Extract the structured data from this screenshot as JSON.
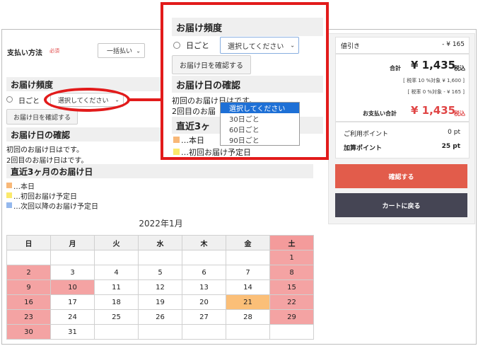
{
  "payment": {
    "label": "支払い方法",
    "required": "必須",
    "method": "一括払い"
  },
  "frequency": {
    "heading": "お届け頻度",
    "radio_label": "日ごと",
    "select_placeholder": "選択してください",
    "confirm_button": "お届け日を確認する",
    "options": [
      "選択してください",
      "30日ごと",
      "60日ごと",
      "90日ごと"
    ]
  },
  "confirm_section": {
    "heading": "お届け日の確認",
    "line1": "初回のお届け日はです。",
    "line2": "2回目のお届け日はです。",
    "line2_short": "2回目のお届"
  },
  "recent": {
    "heading": "直近3ヶ月のお届け日",
    "heading_short": "直近3ヶ",
    "legend": [
      {
        "label": "…本日",
        "color": "#f8b878"
      },
      {
        "label": "…初回お届け予定日",
        "color": "#fbe96c"
      },
      {
        "label": "…次回以降のお届け予定日",
        "color": "#94b8ee"
      }
    ],
    "legend2_clipped": "…初回お届け予定日"
  },
  "calendar": {
    "title": "2022年1月",
    "weekdays": [
      "日",
      "月",
      "火",
      "水",
      "木",
      "金",
      "土"
    ],
    "weeks": [
      [
        "",
        "",
        "",
        "",
        "",
        "",
        "1"
      ],
      [
        "2",
        "3",
        "4",
        "5",
        "6",
        "7",
        "8"
      ],
      [
        "9",
        "10",
        "11",
        "12",
        "13",
        "14",
        "15"
      ],
      [
        "16",
        "17",
        "18",
        "19",
        "20",
        "21",
        "22"
      ],
      [
        "23",
        "24",
        "25",
        "26",
        "27",
        "28",
        "29"
      ],
      [
        "30",
        "31",
        "",
        "",
        "",
        "",
        ""
      ]
    ],
    "red_days": [
      "1",
      "2",
      "8",
      "9",
      "10",
      "15",
      "16",
      "22",
      "23",
      "29",
      "30"
    ],
    "today": "21"
  },
  "summary": {
    "discount_label": "値引き",
    "discount_value": "- ¥ 165",
    "total_label": "合計",
    "total_amount": "¥ 1,435",
    "tax_in": "税込",
    "tax10": "[ 税率 10 %対象  ¥ 1,600 ]",
    "tax0": "[ 税率 0 %対象  - ¥ 165 ]",
    "payment_total_label": "お支払い合計",
    "payment_total_amount": "¥ 1,435",
    "points_used_label": "ご利用ポイント",
    "points_used_value": "0 pt",
    "points_added_label": "加算ポイント",
    "points_added_value": "25 pt",
    "confirm_button": "確認する",
    "back_button": "カートに戻る"
  },
  "colors": {
    "accent_red": "#e25c4b",
    "callout_red": "#e21b1b",
    "dark_button": "#454554",
    "selected_option": "#1e70d6"
  }
}
